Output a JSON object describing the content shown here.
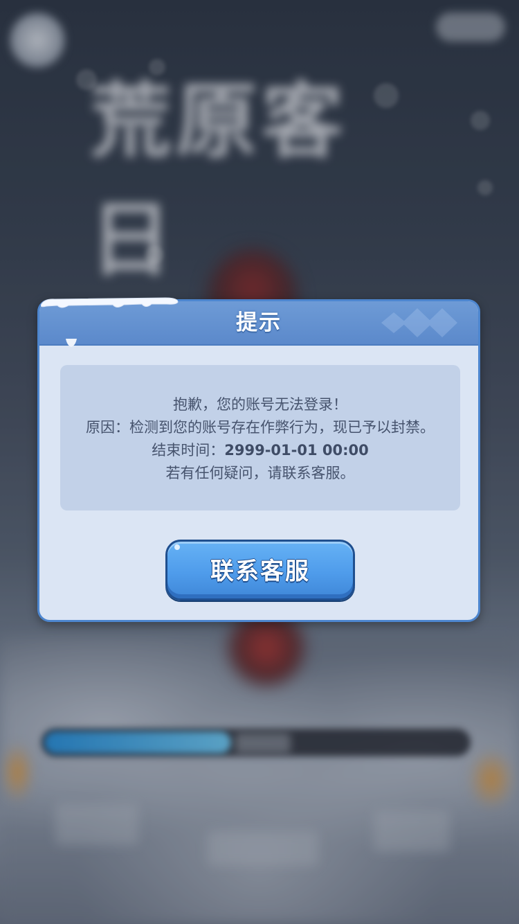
{
  "background": {
    "logo_text": "荒原客日"
  },
  "dialog": {
    "title": "提示",
    "message": {
      "line1": "抱歉，您的账号无法登录！",
      "line2": "原因：检测到您的账号存在作弊行为，现已予以封禁。",
      "end_time_label": "结束时间：",
      "end_time_value": "2999-01-01 00:00",
      "line4": "若有任何疑问，请联系客服。"
    },
    "contact_button_label": "联系客服"
  },
  "colors": {
    "header_blue": "#5b89cb",
    "dialog_bg": "#dbe5f4",
    "message_bg": "#c2d1e8",
    "button_blue": "#4f9ceb",
    "text_dark": "#46536d"
  }
}
